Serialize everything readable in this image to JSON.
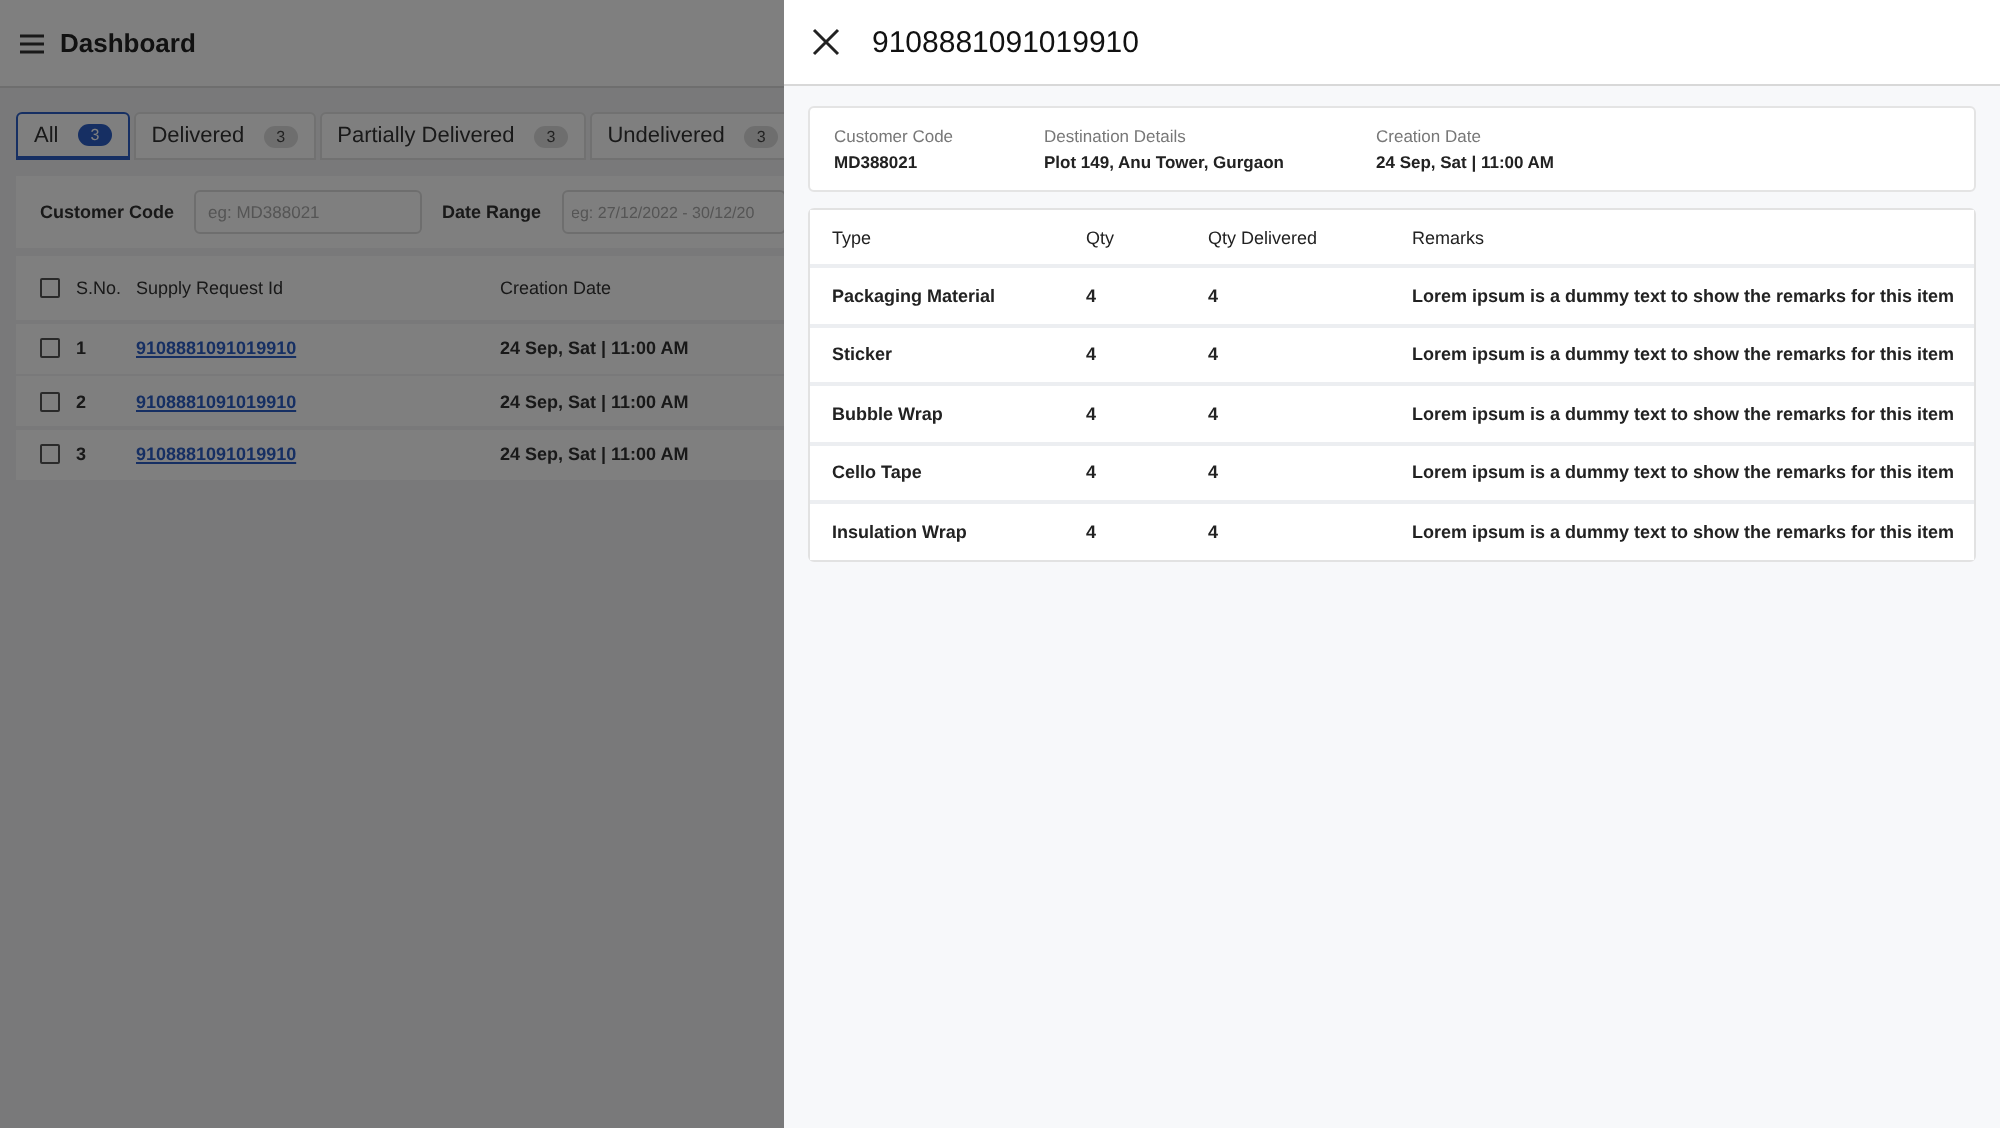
{
  "page": {
    "title": "Dashboard",
    "tabs": [
      {
        "label": "All",
        "count": "3",
        "selected": true
      },
      {
        "label": "Delivered",
        "count": "3",
        "selected": false
      },
      {
        "label": "Partially Delivered",
        "count": "3",
        "selected": false
      },
      {
        "label": "Undelivered",
        "count": "3",
        "selected": false
      }
    ],
    "filters": [
      {
        "label": "Customer Code",
        "placeholder": "eg: MD388021"
      },
      {
        "label": "Date Range",
        "placeholder": "eg: 27/12/2022 - 30/12/20"
      }
    ],
    "table": {
      "select_all_checked": false,
      "columns": [
        "S.No.",
        "Supply Request Id",
        "Creation Date"
      ],
      "rows": [
        {
          "checked": false,
          "sno": "1",
          "id": "9108881091019910",
          "date": "24 Sep, Sat | 11:00 AM"
        },
        {
          "checked": false,
          "sno": "2",
          "id": "9108881091019910",
          "date": "24 Sep, Sat | 11:00 AM"
        },
        {
          "checked": false,
          "sno": "3",
          "id": "9108881091019910",
          "date": "24 Sep, Sat | 11:00 AM"
        }
      ]
    }
  },
  "drawer": {
    "title": "9108881091019910",
    "details": [
      {
        "label": "Customer Code",
        "value": "MD388021"
      },
      {
        "label": "Destination Details",
        "value": "Plot 149, Anu Tower, Gurgaon"
      },
      {
        "label": "Creation Date",
        "value": "24 Sep, Sat | 11:00 AM"
      }
    ],
    "table": {
      "columns": [
        "Type",
        "Qty",
        "Qty Delivered",
        "Remarks"
      ],
      "rows": [
        [
          "Packaging Material",
          "4",
          "4",
          "Lorem ipsum is a dummy text to show the remarks for this item"
        ],
        [
          "Sticker",
          "4",
          "4",
          "Lorem ipsum is a dummy text to show the remarks for this item"
        ],
        [
          "Bubble Wrap",
          "4",
          "4",
          "Lorem ipsum is a dummy text to show the remarks for this item"
        ],
        [
          "Cello Tape",
          "4",
          "4",
          "Lorem ipsum is a dummy text to show the remarks for this item"
        ],
        [
          "Insulation Wrap",
          "4",
          "4",
          "Lorem ipsum is a dummy text to show the remarks for this item"
        ]
      ]
    }
  }
}
